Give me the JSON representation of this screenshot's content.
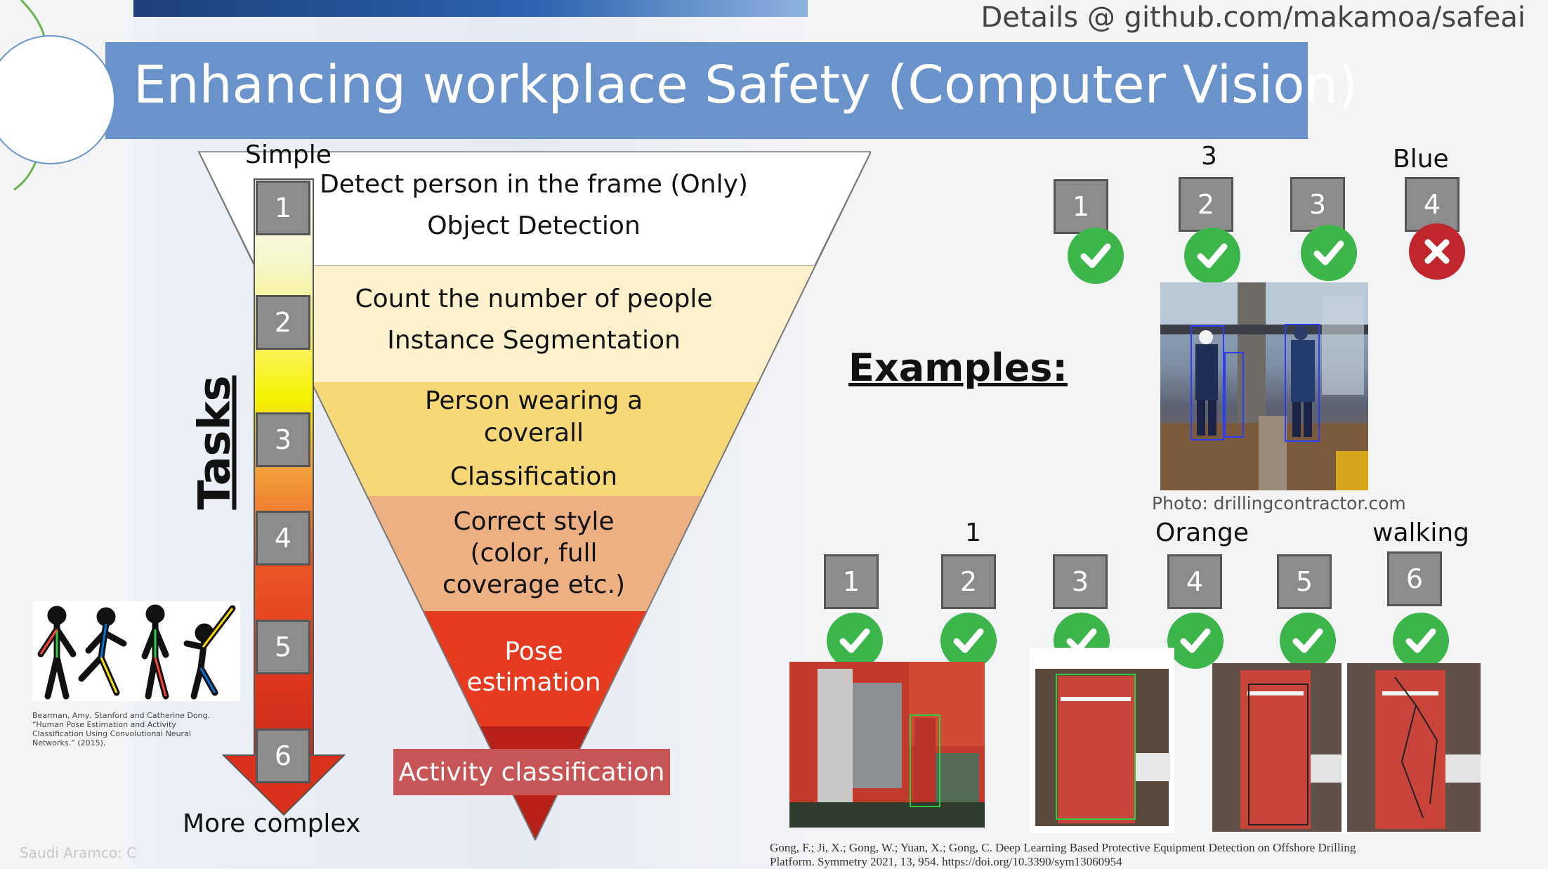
{
  "header": {
    "details": "Details @ github.com/makamoa/safeai",
    "title": "Enhancing  workplace Safety (Computer Vision)"
  },
  "funnel": {
    "top_label": "Simple",
    "bottom_label": "More complex",
    "axis_label": "Tasks",
    "steps": [
      "1",
      "2",
      "3",
      "4",
      "5",
      "6"
    ],
    "levels": [
      {
        "line1": "Detect person in the frame (Only)",
        "line2": "Object Detection",
        "color": "#ffffff"
      },
      {
        "line1": "Count the number of people",
        "line2": "Instance Segmentation",
        "color": "#fdf1cd"
      },
      {
        "line1": "Person wearing a",
        "line2": "coverall",
        "line3": "Classification",
        "color": "#f7d878"
      },
      {
        "line1": "Correct style",
        "line2": "(color, full",
        "line3": "coverage etc.)",
        "color": "#edb083"
      },
      {
        "line1": "Pose",
        "line2": "estimation",
        "color": "#e63a20"
      },
      {
        "line1": "Activity classification",
        "color": "#b62018"
      }
    ]
  },
  "pose_caption": "Bearman, Amy, Stanford and Catherine Dong. “Human Pose Estimation and Activity Classification Using Convolutional Neural Networks.” (2015).",
  "footer_left": "Saudi Aramco: C",
  "examples": {
    "heading": "Examples:",
    "top": {
      "values": [
        "",
        "3",
        "",
        "Blue"
      ],
      "steps": [
        "1",
        "2",
        "3",
        "4"
      ],
      "status": [
        "check",
        "check",
        "check",
        "cross"
      ],
      "photo_credit": "Photo: drillingcontractor.com"
    },
    "bottom": {
      "values": [
        "",
        "1",
        "",
        "Orange",
        "",
        "walking"
      ],
      "steps": [
        "1",
        "2",
        "3",
        "4",
        "5",
        "6"
      ],
      "status": [
        "check",
        "check",
        "check",
        "check",
        "check",
        "check"
      ]
    },
    "reference_line1": "Gong, F.; Ji, X.; Gong, W.; Yuan, X.; Gong, C. Deep Learning Based Protective Equipment Detection on Offshore Drilling",
    "reference_line2": "Platform. Symmetry 2021, 13, 954. https://doi.org/10.3390/sym13060954"
  },
  "colors": {
    "title_bar": "#6a93cb",
    "check": "#3cb54a",
    "cross": "#c0272d"
  }
}
